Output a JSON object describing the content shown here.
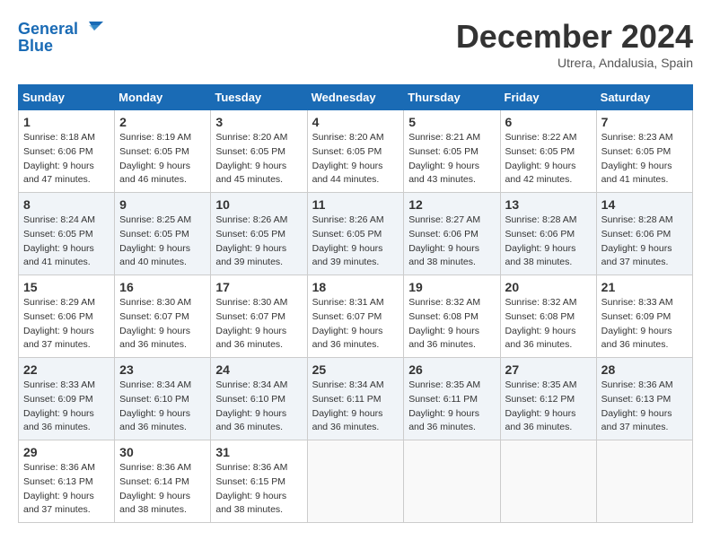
{
  "header": {
    "logo_line1": "General",
    "logo_line2": "Blue",
    "month": "December 2024",
    "location": "Utrera, Andalusia, Spain"
  },
  "weekdays": [
    "Sunday",
    "Monday",
    "Tuesday",
    "Wednesday",
    "Thursday",
    "Friday",
    "Saturday"
  ],
  "weeks": [
    [
      {
        "day": "1",
        "sunrise": "8:18 AM",
        "sunset": "6:06 PM",
        "daylight": "9 hours and 47 minutes."
      },
      {
        "day": "2",
        "sunrise": "8:19 AM",
        "sunset": "6:05 PM",
        "daylight": "9 hours and 46 minutes."
      },
      {
        "day": "3",
        "sunrise": "8:20 AM",
        "sunset": "6:05 PM",
        "daylight": "9 hours and 45 minutes."
      },
      {
        "day": "4",
        "sunrise": "8:20 AM",
        "sunset": "6:05 PM",
        "daylight": "9 hours and 44 minutes."
      },
      {
        "day": "5",
        "sunrise": "8:21 AM",
        "sunset": "6:05 PM",
        "daylight": "9 hours and 43 minutes."
      },
      {
        "day": "6",
        "sunrise": "8:22 AM",
        "sunset": "6:05 PM",
        "daylight": "9 hours and 42 minutes."
      },
      {
        "day": "7",
        "sunrise": "8:23 AM",
        "sunset": "6:05 PM",
        "daylight": "9 hours and 41 minutes."
      }
    ],
    [
      {
        "day": "8",
        "sunrise": "8:24 AM",
        "sunset": "6:05 PM",
        "daylight": "9 hours and 41 minutes."
      },
      {
        "day": "9",
        "sunrise": "8:25 AM",
        "sunset": "6:05 PM",
        "daylight": "9 hours and 40 minutes."
      },
      {
        "day": "10",
        "sunrise": "8:26 AM",
        "sunset": "6:05 PM",
        "daylight": "9 hours and 39 minutes."
      },
      {
        "day": "11",
        "sunrise": "8:26 AM",
        "sunset": "6:05 PM",
        "daylight": "9 hours and 39 minutes."
      },
      {
        "day": "12",
        "sunrise": "8:27 AM",
        "sunset": "6:06 PM",
        "daylight": "9 hours and 38 minutes."
      },
      {
        "day": "13",
        "sunrise": "8:28 AM",
        "sunset": "6:06 PM",
        "daylight": "9 hours and 38 minutes."
      },
      {
        "day": "14",
        "sunrise": "8:28 AM",
        "sunset": "6:06 PM",
        "daylight": "9 hours and 37 minutes."
      }
    ],
    [
      {
        "day": "15",
        "sunrise": "8:29 AM",
        "sunset": "6:06 PM",
        "daylight": "9 hours and 37 minutes."
      },
      {
        "day": "16",
        "sunrise": "8:30 AM",
        "sunset": "6:07 PM",
        "daylight": "9 hours and 36 minutes."
      },
      {
        "day": "17",
        "sunrise": "8:30 AM",
        "sunset": "6:07 PM",
        "daylight": "9 hours and 36 minutes."
      },
      {
        "day": "18",
        "sunrise": "8:31 AM",
        "sunset": "6:07 PM",
        "daylight": "9 hours and 36 minutes."
      },
      {
        "day": "19",
        "sunrise": "8:32 AM",
        "sunset": "6:08 PM",
        "daylight": "9 hours and 36 minutes."
      },
      {
        "day": "20",
        "sunrise": "8:32 AM",
        "sunset": "6:08 PM",
        "daylight": "9 hours and 36 minutes."
      },
      {
        "day": "21",
        "sunrise": "8:33 AM",
        "sunset": "6:09 PM",
        "daylight": "9 hours and 36 minutes."
      }
    ],
    [
      {
        "day": "22",
        "sunrise": "8:33 AM",
        "sunset": "6:09 PM",
        "daylight": "9 hours and 36 minutes."
      },
      {
        "day": "23",
        "sunrise": "8:34 AM",
        "sunset": "6:10 PM",
        "daylight": "9 hours and 36 minutes."
      },
      {
        "day": "24",
        "sunrise": "8:34 AM",
        "sunset": "6:10 PM",
        "daylight": "9 hours and 36 minutes."
      },
      {
        "day": "25",
        "sunrise": "8:34 AM",
        "sunset": "6:11 PM",
        "daylight": "9 hours and 36 minutes."
      },
      {
        "day": "26",
        "sunrise": "8:35 AM",
        "sunset": "6:11 PM",
        "daylight": "9 hours and 36 minutes."
      },
      {
        "day": "27",
        "sunrise": "8:35 AM",
        "sunset": "6:12 PM",
        "daylight": "9 hours and 36 minutes."
      },
      {
        "day": "28",
        "sunrise": "8:36 AM",
        "sunset": "6:13 PM",
        "daylight": "9 hours and 37 minutes."
      }
    ],
    [
      {
        "day": "29",
        "sunrise": "8:36 AM",
        "sunset": "6:13 PM",
        "daylight": "9 hours and 37 minutes."
      },
      {
        "day": "30",
        "sunrise": "8:36 AM",
        "sunset": "6:14 PM",
        "daylight": "9 hours and 38 minutes."
      },
      {
        "day": "31",
        "sunrise": "8:36 AM",
        "sunset": "6:15 PM",
        "daylight": "9 hours and 38 minutes."
      },
      null,
      null,
      null,
      null
    ]
  ]
}
